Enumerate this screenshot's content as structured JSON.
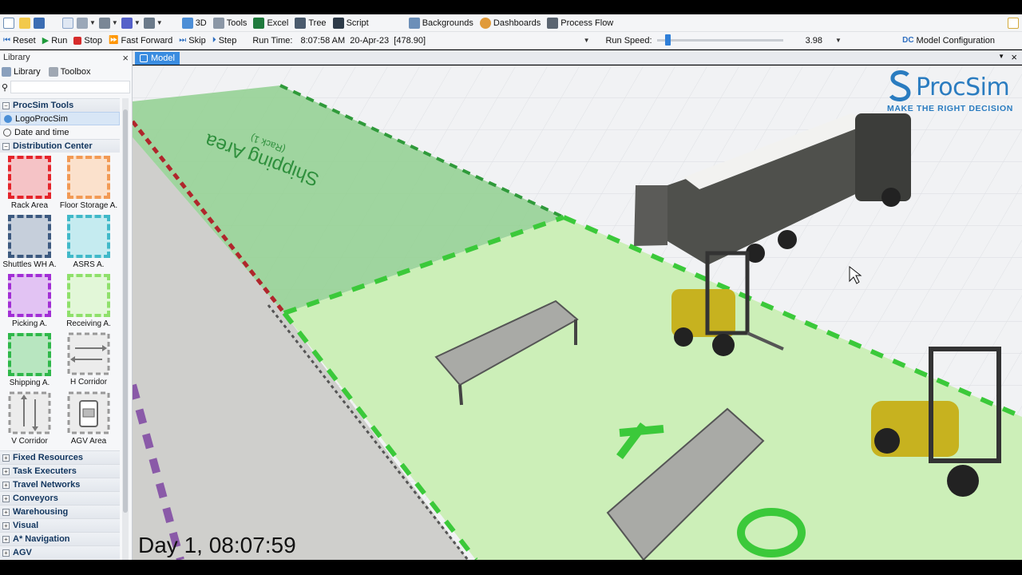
{
  "toolbar_main": {
    "items": [
      {
        "label": "3D",
        "icon": "3d-icon"
      },
      {
        "label": "Tools",
        "icon": "tools-icon"
      },
      {
        "label": "Excel",
        "icon": "excel-icon"
      },
      {
        "label": "Tree",
        "icon": "tree-icon"
      },
      {
        "label": "Script",
        "icon": "script-icon"
      }
    ],
    "right_items": [
      {
        "label": "Backgrounds",
        "icon": "backgrounds-icon"
      },
      {
        "label": "Dashboards",
        "icon": "dashboards-icon"
      },
      {
        "label": "Process Flow",
        "icon": "process-flow-icon"
      }
    ]
  },
  "run_controls": {
    "reset": "Reset",
    "run": "Run",
    "stop": "Stop",
    "fast_forward": "Fast Forward",
    "skip": "Skip",
    "step": "Step",
    "run_time_label": "Run Time:",
    "run_time_value": "8:07:58 AM  20-Apr-23  [478.90]",
    "run_speed_label": "Run Speed:",
    "run_speed_value": "3.98",
    "model_config": "Model Configuration"
  },
  "library": {
    "title": "Library",
    "tabs": {
      "library": "Library",
      "toolbox": "Toolbox"
    },
    "groups": {
      "procsim": "ProcSim Tools",
      "distribution": "Distribution Center"
    },
    "procsim_items": [
      "LogoProcSim",
      "Date and time"
    ],
    "tiles": [
      {
        "label": "Rack Area",
        "color": "#e5242b",
        "fill": "#f5c3c6"
      },
      {
        "label": "Floor Storage A.",
        "color": "#f29a55",
        "fill": "#fbe1cc"
      },
      {
        "label": "Shuttles WH A.",
        "color": "#3d5a80",
        "fill": "#c6cfdb"
      },
      {
        "label": "ASRS A.",
        "color": "#41b9c9",
        "fill": "#c5ebf0"
      },
      {
        "label": "Picking A.",
        "color": "#a22fd6",
        "fill": "#e2c3f3"
      },
      {
        "label": "Receiving A.",
        "color": "#8fe06b",
        "fill": "#e2f7d8"
      },
      {
        "label": "Shipping A.",
        "color": "#2fb84a",
        "fill": "#b8e6c0"
      },
      {
        "label": "H Corridor"
      },
      {
        "label": "V Corridor"
      },
      {
        "label": "AGV Area"
      }
    ],
    "collapsed_groups": [
      "Fixed Resources",
      "Task Executers",
      "Travel Networks",
      "Conveyors",
      "Warehousing",
      "Visual",
      "A* Navigation",
      "AGV"
    ]
  },
  "model_tab": "Model",
  "viewport": {
    "shipping_label": "Shipping Area",
    "shipping_sublabel": "(Rack 1)",
    "clock": "Day 1, 08:07:59",
    "logo_name": "ProcSim",
    "logo_tagline": "MAKE THE RIGHT DECISION"
  }
}
